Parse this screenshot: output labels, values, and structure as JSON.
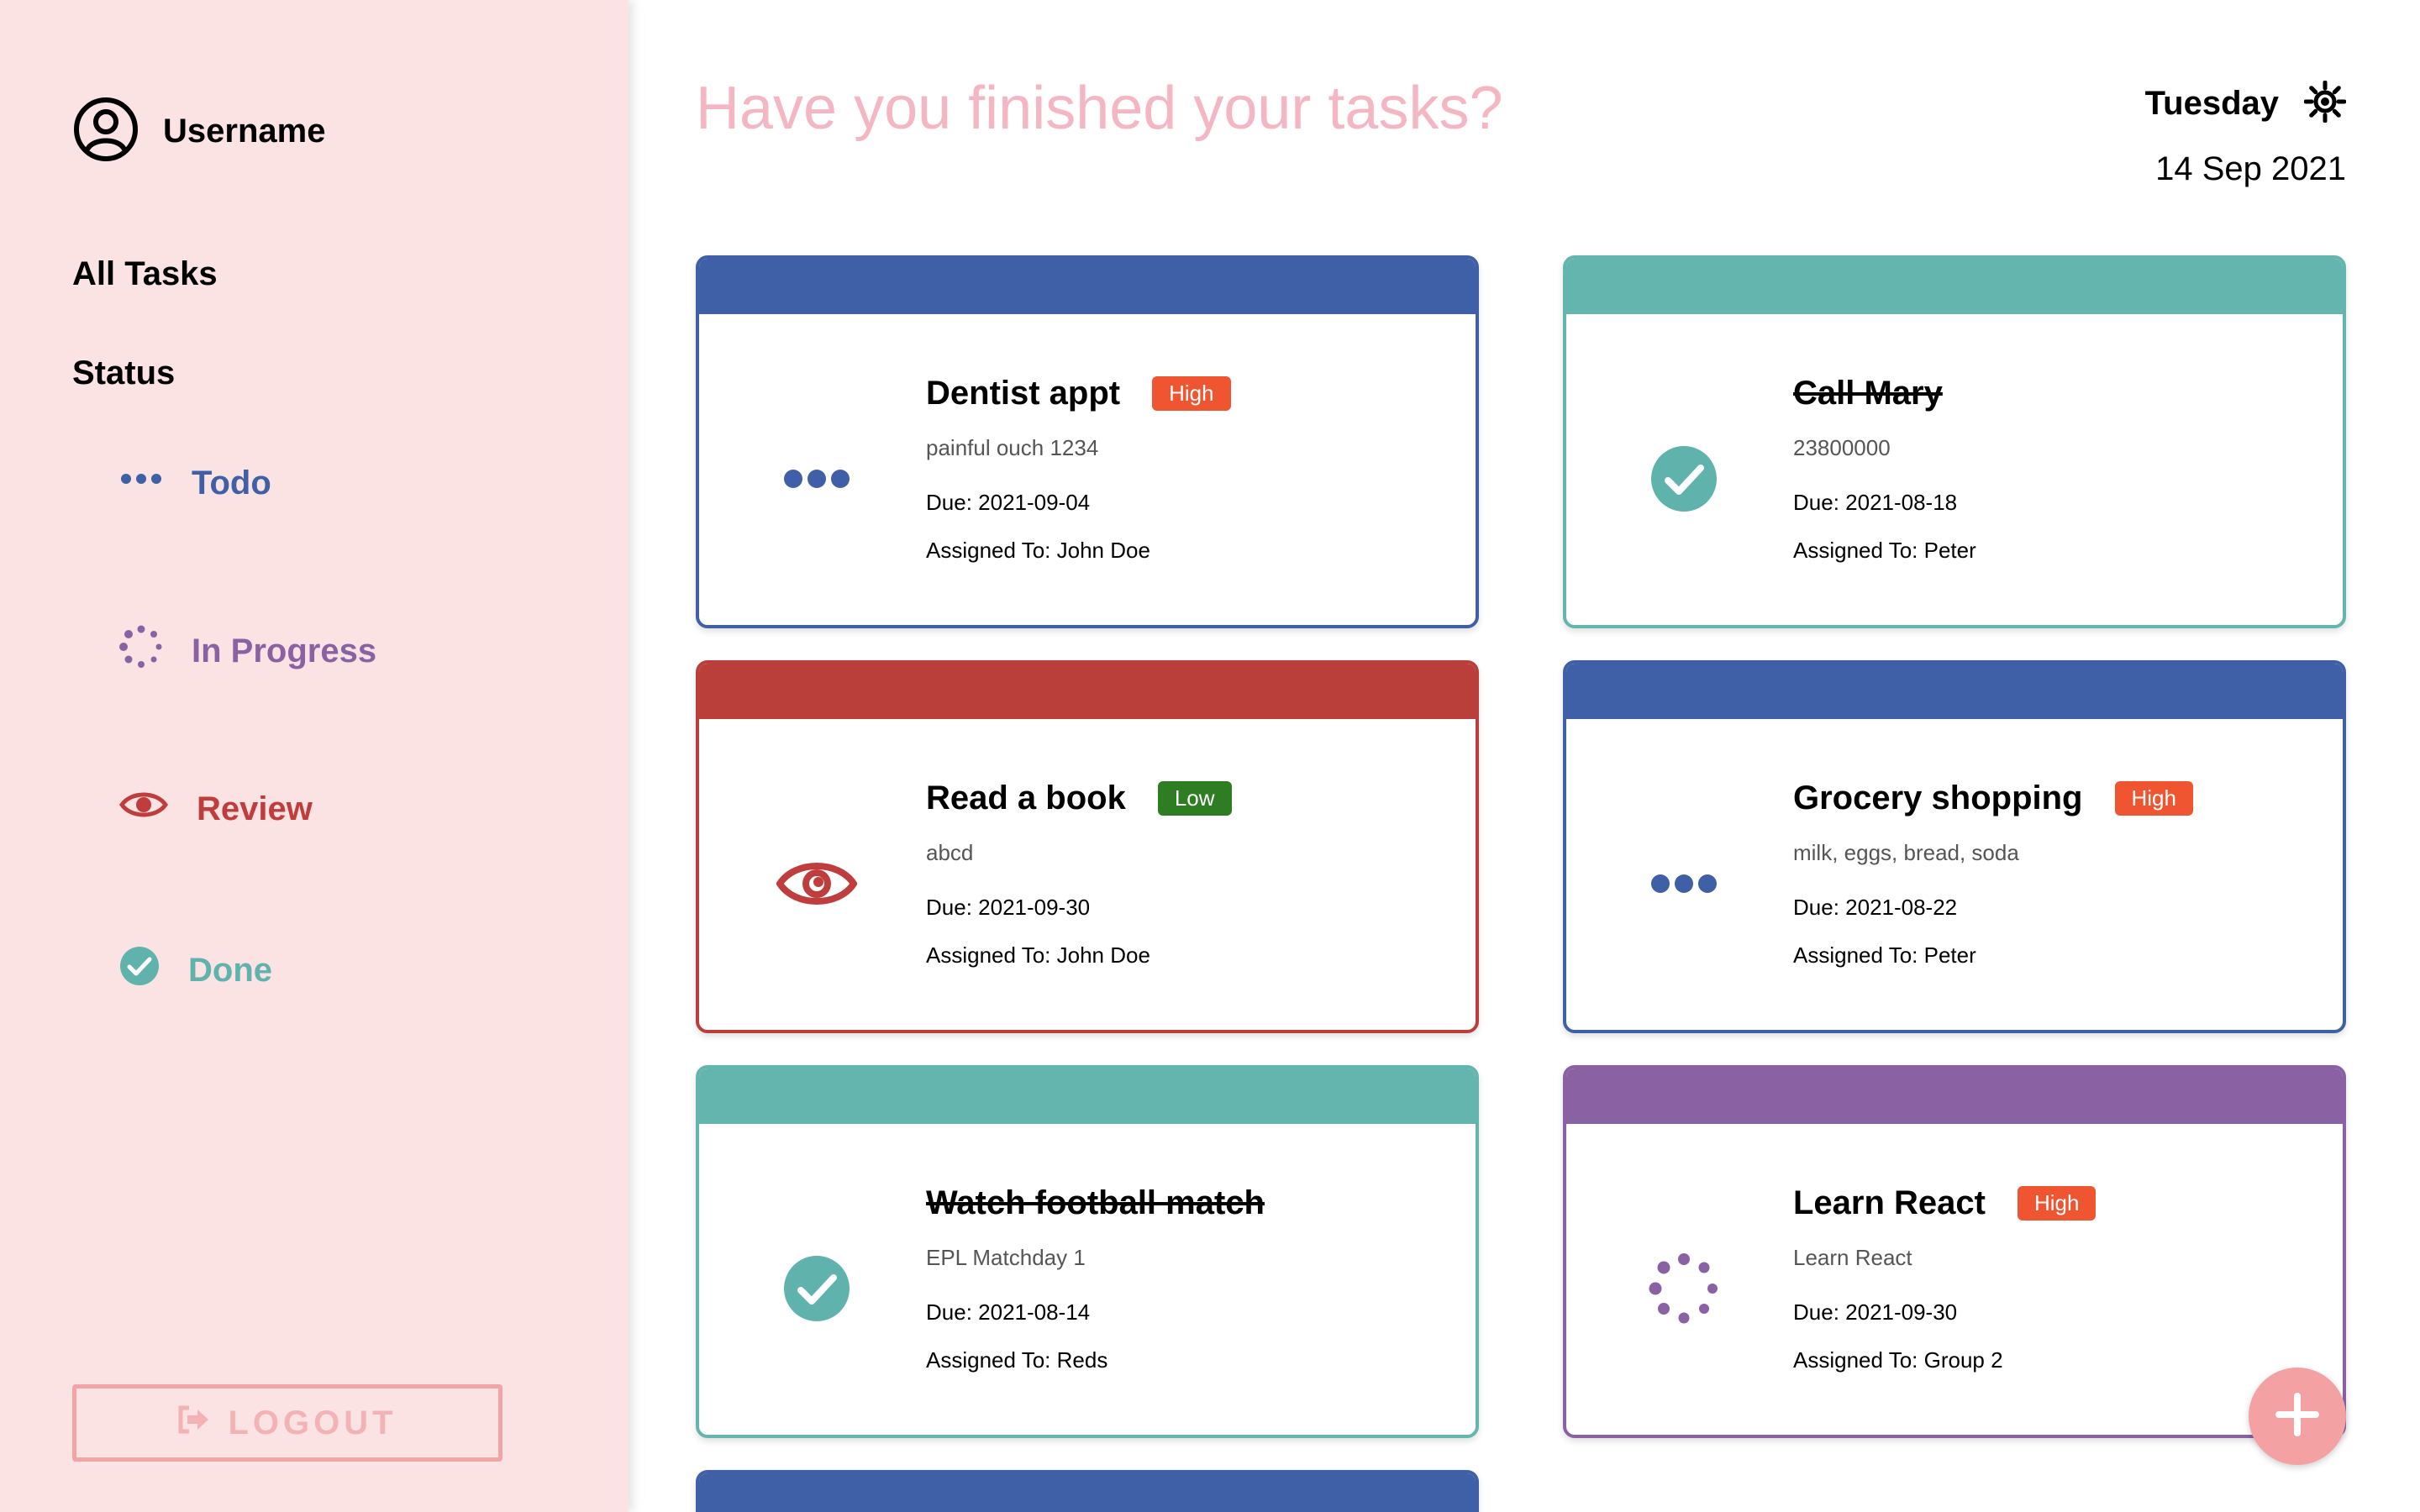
{
  "sidebar": {
    "username": "Username",
    "all_tasks_label": "All Tasks",
    "status_label": "Status",
    "statuses": [
      {
        "label": "Todo",
        "color": "#3f5fa6",
        "icon": "three-dots-icon"
      },
      {
        "label": "In Progress",
        "color": "#8a62a4",
        "icon": "spinner-dots-icon"
      },
      {
        "label": "Review",
        "color": "#bf3d3d",
        "icon": "eye-icon"
      },
      {
        "label": "Done",
        "color": "#5fb3ac",
        "icon": "check-circle-icon"
      }
    ],
    "logout_label": "LOGOUT"
  },
  "header": {
    "heading": "Have you finished your tasks?",
    "day": "Tuesday",
    "date": "14 Sep 2021"
  },
  "tasks": [
    {
      "title": "Dentist appt",
      "priority": "High",
      "description": "painful ouch 1234",
      "due": "Due: 2021-09-04",
      "assigned": "Assigned To: John Doe",
      "status": "Todo",
      "color": "#3f5fa6"
    },
    {
      "title": "Call Mary",
      "priority": "",
      "description": "23800000",
      "due": "Due: 2021-08-18",
      "assigned": "Assigned To: Peter",
      "status": "Done",
      "color": "#64b5ad"
    },
    {
      "title": "Read a book",
      "priority": "Low",
      "description": "abcd",
      "due": "Due: 2021-09-30",
      "assigned": "Assigned To: John Doe",
      "status": "Review",
      "color": "#ba3f3a"
    },
    {
      "title": "Grocery shopping",
      "priority": "High",
      "description": "milk, eggs, bread, soda",
      "due": "Due: 2021-08-22",
      "assigned": "Assigned To: Peter",
      "status": "Todo",
      "color": "#3f5fa6"
    },
    {
      "title": "Watch football match",
      "priority": "",
      "description": "EPL Matchday 1",
      "due": "Due: 2021-08-14",
      "assigned": "Assigned To: Reds",
      "status": "Done",
      "color": "#64b5ad"
    },
    {
      "title": "Learn React",
      "priority": "High",
      "description": "Learn React",
      "due": "Due: 2021-09-30",
      "assigned": "Assigned To: Group 2",
      "status": "In Progress",
      "color": "#8a62a4"
    }
  ],
  "colors": {
    "high_badge": "#ee5530",
    "low_badge": "#2e7d22",
    "heading": "#f4b6c2",
    "sidebar_bg": "#fbe3e4",
    "fab": "#f3a1a3"
  }
}
